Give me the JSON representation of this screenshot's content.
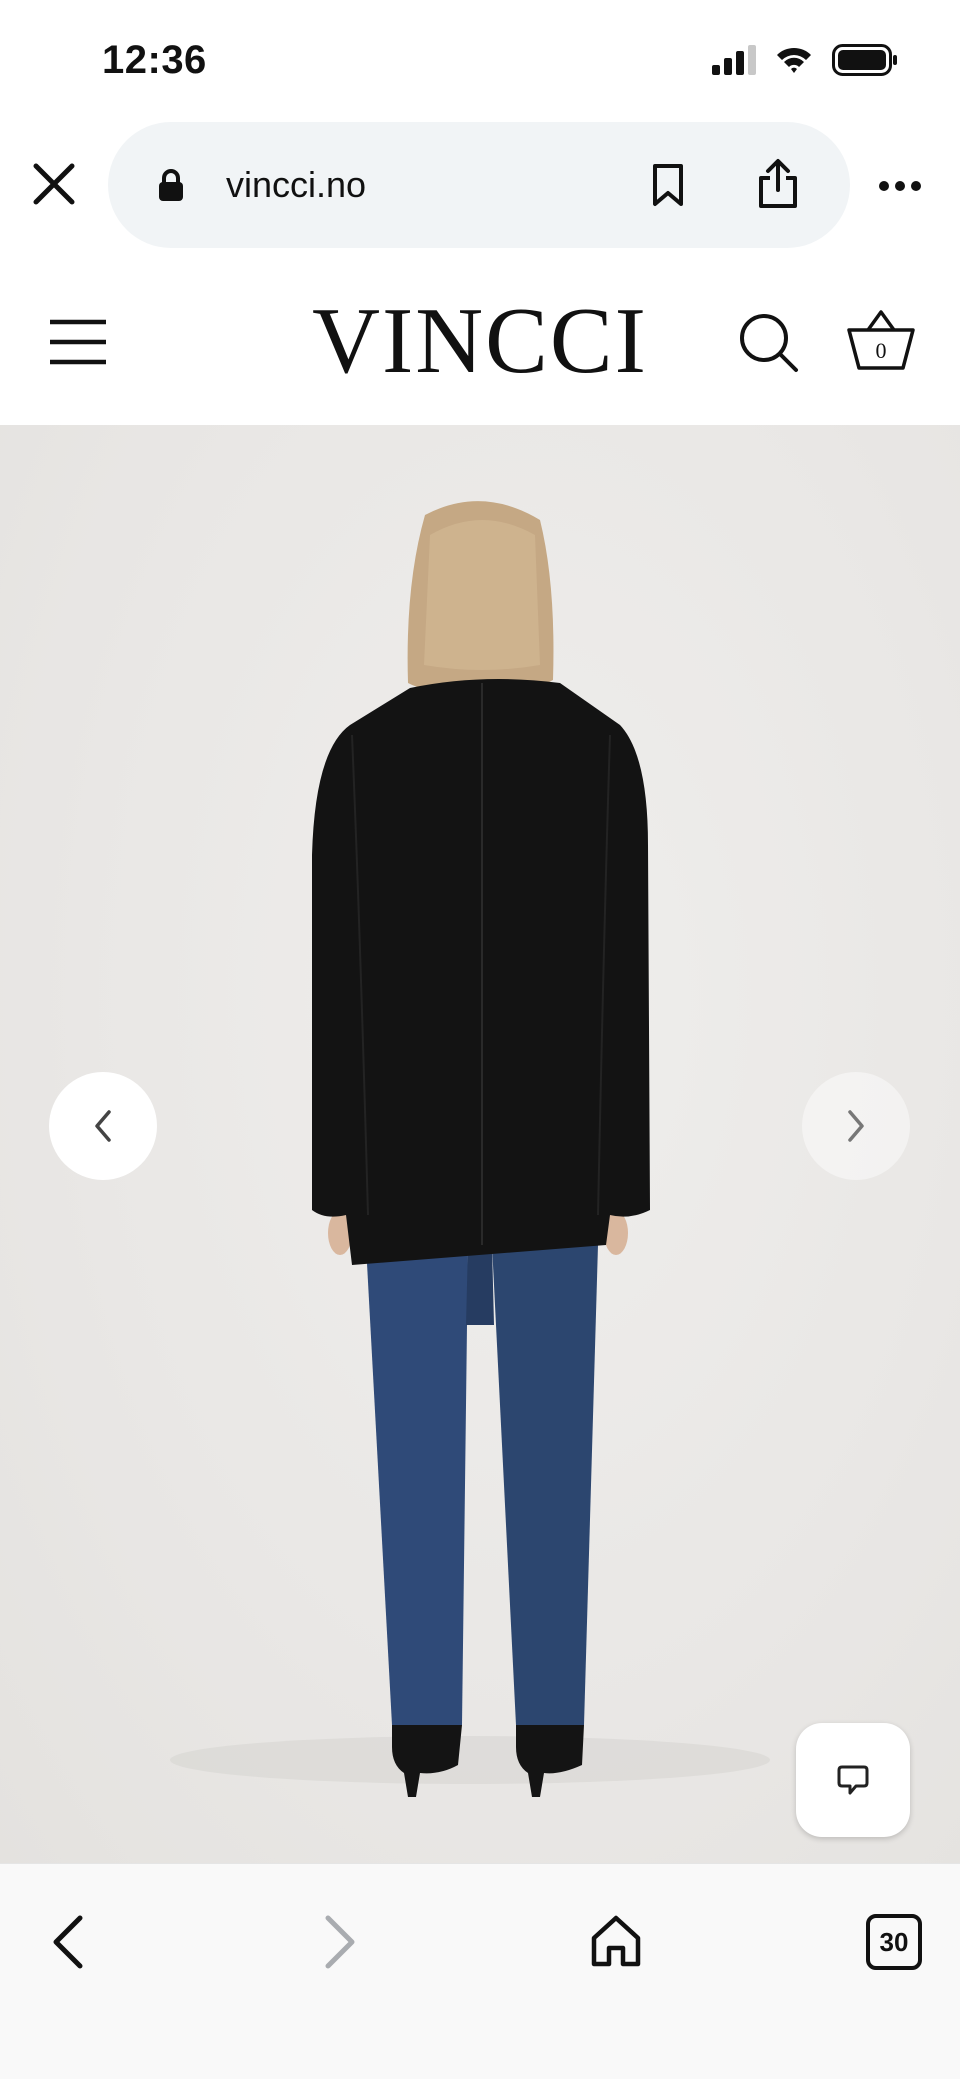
{
  "status_bar": {
    "time": "12:36",
    "icons": [
      "signal-icon",
      "wifi-icon",
      "battery-icon"
    ]
  },
  "browser": {
    "url": "vincci.no",
    "icons": [
      "close-icon",
      "lock-icon",
      "bookmark-icon",
      "share-icon",
      "more-icon"
    ]
  },
  "site_header": {
    "logo": "VINCCI",
    "cart_count": "0",
    "icons": [
      "menu-icon",
      "search-icon",
      "basket-icon"
    ]
  },
  "carousel": {
    "icons": [
      "chevron-left-icon",
      "chevron-right-icon",
      "chat-icon"
    ]
  },
  "toolbar": {
    "tab_count": "30",
    "icons": [
      "back-icon",
      "forward-icon",
      "home-icon",
      "tabs-icon"
    ]
  },
  "colors": {
    "background": "#ffffff",
    "url_pill": "#f1f4f6",
    "photo_backdrop": "#ebe9e7",
    "jacket": "#131313",
    "jeans": "#2f4a78",
    "disabled_icon": "#a9acb0"
  }
}
